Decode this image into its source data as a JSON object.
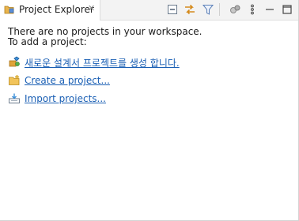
{
  "tab": {
    "label": "Project Explorer",
    "close_glyph": "✕",
    "icon": "project-explorer-icon"
  },
  "toolbar": [
    {
      "name": "collapse-all-icon"
    },
    {
      "name": "link-with-editor-icon"
    },
    {
      "name": "filter-icon"
    },
    {
      "name": "scm-sync-icon"
    },
    {
      "name": "view-menu-icon"
    },
    {
      "name": "minimize-icon"
    },
    {
      "name": "maximize-icon"
    }
  ],
  "message": {
    "line1": "There are no projects in your workspace.",
    "line2": "To add a project:"
  },
  "links": [
    {
      "label": "새로운 설계서 프로젝트를 생성 합니다.",
      "icon": "new-design-project-icon"
    },
    {
      "label": "Create a project...",
      "icon": "new-project-icon"
    },
    {
      "label": "Import projects...",
      "icon": "import-projects-icon"
    }
  ],
  "colors": {
    "link": "#1a5fb4",
    "tab_bg": "#f3f3f3"
  }
}
